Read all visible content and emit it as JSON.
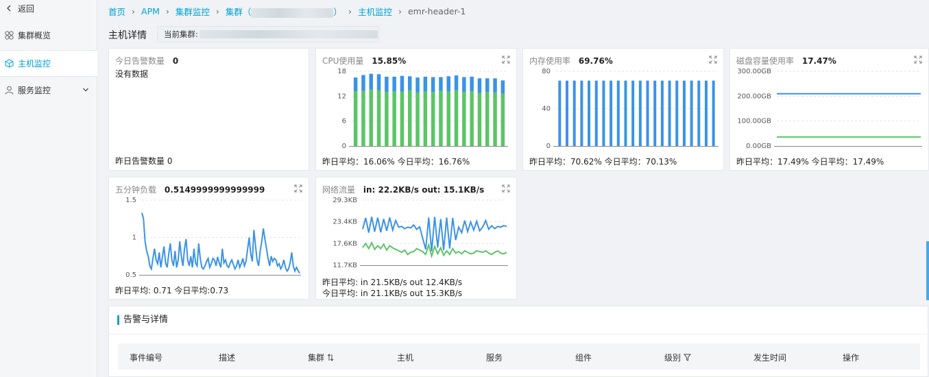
{
  "sidebar": {
    "back": "返回",
    "items": [
      {
        "label": "集群概览",
        "icon": "grid-icon"
      },
      {
        "label": "主机监控",
        "icon": "cube-icon",
        "active": true
      },
      {
        "label": "服务监控",
        "icon": "user-icon"
      }
    ]
  },
  "breadcrumb": {
    "home": "首页",
    "apm": "APM",
    "cluster_monitor": "集群监控",
    "cluster_prefix": "集群（",
    "cluster_suffix": "）",
    "host_monitor": "主机监控",
    "current": "emr-header-1"
  },
  "header": {
    "title": "主机详情",
    "current_cluster_label": "当前集群:"
  },
  "cards": {
    "alerts_today": {
      "label": "今日告警数量",
      "value": "0",
      "no_data": "没有数据",
      "footer": "昨日告警数量 0"
    },
    "cpu": {
      "label": "CPU使用量",
      "value": "15.85%",
      "footer": "昨日平均：16.06% 今日平均：16.76%"
    },
    "memory": {
      "label": "内存使用率",
      "value": "69.76%",
      "footer": "昨日平均：70.62% 今日平均：70.13%"
    },
    "disk": {
      "label": "磁盘容量使用率",
      "value": "17.47%",
      "footer": "昨日平均：17.49% 今日平均：17.49%"
    },
    "load": {
      "label": "五分钟负载",
      "value": "0.5149999999999999",
      "footer": "昨日平均: 0.71  今日平均:0.73"
    },
    "network": {
      "label": "网络流量",
      "value": "in: 22.2KB/s out: 15.1KB/s",
      "footer_1": "昨日平均: in 21.5KB/s out 12.4KB/s",
      "footer_2": "今日平均: in 21.1KB/s out 15.3KB/s"
    }
  },
  "chart_data": [
    {
      "type": "bar",
      "name": "cpu",
      "ylim": [
        0,
        18
      ],
      "yticks": [
        "18",
        "12",
        "6",
        "0"
      ],
      "series": [
        {
          "values": [
            13.2,
            13.3,
            13.6,
            13.4,
            13.0,
            13.2,
            13.1,
            13.4,
            12.9,
            13.2,
            13.0,
            13.3,
            13.1,
            13.4,
            13.0,
            13.2,
            12.8,
            13.0,
            12.9,
            12.6
          ]
        },
        {
          "values": [
            3.3,
            3.8,
            3.8,
            3.9,
            3.7,
            3.5,
            3.8,
            3.4,
            3.6,
            3.5,
            3.6,
            3.3,
            3.7,
            3.6,
            3.6,
            3.5,
            3.5,
            3.3,
            3.4,
            3.2
          ]
        }
      ],
      "colors": [
        "#5cc466",
        "#3a93e6"
      ]
    },
    {
      "type": "bar",
      "name": "memory",
      "ylim": [
        0,
        80
      ],
      "yticks": [
        "80",
        "40",
        "0"
      ],
      "series": [
        {
          "values": [
            70,
            70,
            70,
            70,
            70,
            70,
            70,
            70,
            70,
            70,
            70,
            70,
            70,
            70,
            70,
            70,
            70,
            70,
            70,
            70,
            70,
            70
          ]
        }
      ],
      "colors": [
        "#3a93e6"
      ]
    },
    {
      "type": "line",
      "name": "disk",
      "ylim": [
        0,
        300
      ],
      "yticks": [
        "300.00GB",
        "200.00GB",
        "100.00GB",
        "0.00GB"
      ],
      "series": [
        {
          "values": [
            210,
            210,
            210,
            210,
            210,
            210,
            210,
            210,
            210,
            210,
            210,
            210,
            210,
            210,
            210,
            210,
            210,
            210,
            210,
            210
          ]
        },
        {
          "values": [
            36,
            36,
            36,
            36,
            36,
            36,
            36,
            36,
            36,
            36,
            36,
            36,
            36,
            36,
            36,
            36,
            36,
            36,
            36,
            36
          ]
        }
      ],
      "colors": [
        "#3a93e6",
        "#5cc466"
      ]
    },
    {
      "type": "line",
      "name": "load",
      "ylim": [
        0.5,
        1.5
      ],
      "yticks": [
        "1.5",
        "1",
        "0.5"
      ],
      "series": [
        {
          "values": [
            1.33,
            1.25,
            0.95,
            0.82,
            0.75,
            0.62,
            0.58,
            0.72,
            0.85,
            0.7,
            0.65,
            0.8,
            0.6,
            0.74,
            0.88,
            0.66,
            0.6,
            0.78,
            0.92,
            0.7,
            0.62,
            0.82,
            0.6,
            0.7,
            0.95,
            0.75,
            0.62,
            0.85,
            0.98,
            0.7,
            0.62,
            0.75,
            0.6,
            0.85,
            0.66,
            0.62,
            0.92,
            0.72,
            0.6,
            0.58,
            0.62,
            0.68,
            0.72,
            0.6,
            0.65,
            0.72,
            0.7,
            0.62,
            0.74,
            0.66,
            0.6,
            0.85,
            0.66,
            0.7,
            0.62,
            0.6,
            0.66,
            0.7,
            0.64,
            0.58,
            0.62,
            0.7,
            0.6,
            0.65,
            0.72,
            0.62,
            0.68,
            0.84,
            1.0,
            0.78,
            0.68,
            1.1,
            0.9,
            0.7,
            0.62,
            0.82,
            0.95,
            1.12,
            0.98,
            0.85,
            0.72,
            0.62,
            0.75,
            0.68,
            0.72,
            0.7,
            0.62,
            0.65,
            0.58,
            0.62,
            0.7,
            0.6,
            0.55,
            0.58,
            0.66,
            0.8,
            0.62,
            0.55,
            0.6,
            0.56,
            0.52
          ]
        }
      ],
      "colors": [
        "#3a93e6"
      ]
    },
    {
      "type": "line",
      "name": "network",
      "ylim": [
        11.7,
        29.3
      ],
      "yticks": [
        "29.3KB",
        "23.4KB",
        "17.6KB",
        "11.7KB"
      ],
      "series": [
        {
          "values": [
            21.5,
            24.5,
            20.5,
            24.8,
            20.8,
            24.6,
            20.6,
            24.2,
            21.0,
            24.6,
            21.2,
            23.8,
            22.0,
            22.2,
            21.6,
            22.0,
            21.8,
            22.6,
            21.4,
            22.1,
            19.0,
            16.0,
            24.6,
            15.5,
            24.8,
            16.5,
            24.2,
            15.8,
            24.6,
            16.2,
            24.5,
            18.5,
            22.0,
            20.5,
            23.8,
            20.8,
            23.4,
            21.2,
            23.6,
            21.0,
            22.0,
            23.8,
            21.4,
            22.4,
            21.6,
            22.2,
            22.0,
            22.4,
            22.2
          ]
        },
        {
          "values": [
            16.5,
            17.6,
            16.2,
            17.8,
            16.0,
            17.0,
            16.2,
            17.4,
            15.8,
            17.0,
            16.4,
            16.0,
            15.6,
            15.2,
            15.8,
            14.6,
            15.2,
            15.4,
            16.2,
            15.8,
            15.4,
            14.6,
            17.2,
            14.2,
            16.8,
            14.8,
            16.4,
            14.4,
            15.6,
            14.6,
            16.2,
            15.0,
            15.4,
            14.8,
            15.6,
            15.2,
            14.8,
            15.0,
            15.6,
            15.4,
            15.2,
            15.6,
            15.0,
            14.6,
            15.2,
            15.6,
            15.0,
            14.8,
            15.2
          ]
        }
      ],
      "colors": [
        "#3a93e6",
        "#5cc466"
      ]
    }
  ],
  "alerts": {
    "title": "告警与详情",
    "columns": [
      "事件编号",
      "描述",
      "集群",
      "主机",
      "服务",
      "组件",
      "级别",
      "发生时间",
      "操作"
    ]
  },
  "colors": {
    "accent": "#00a1d6",
    "blue": "#3a93e6",
    "green": "#5cc466"
  }
}
